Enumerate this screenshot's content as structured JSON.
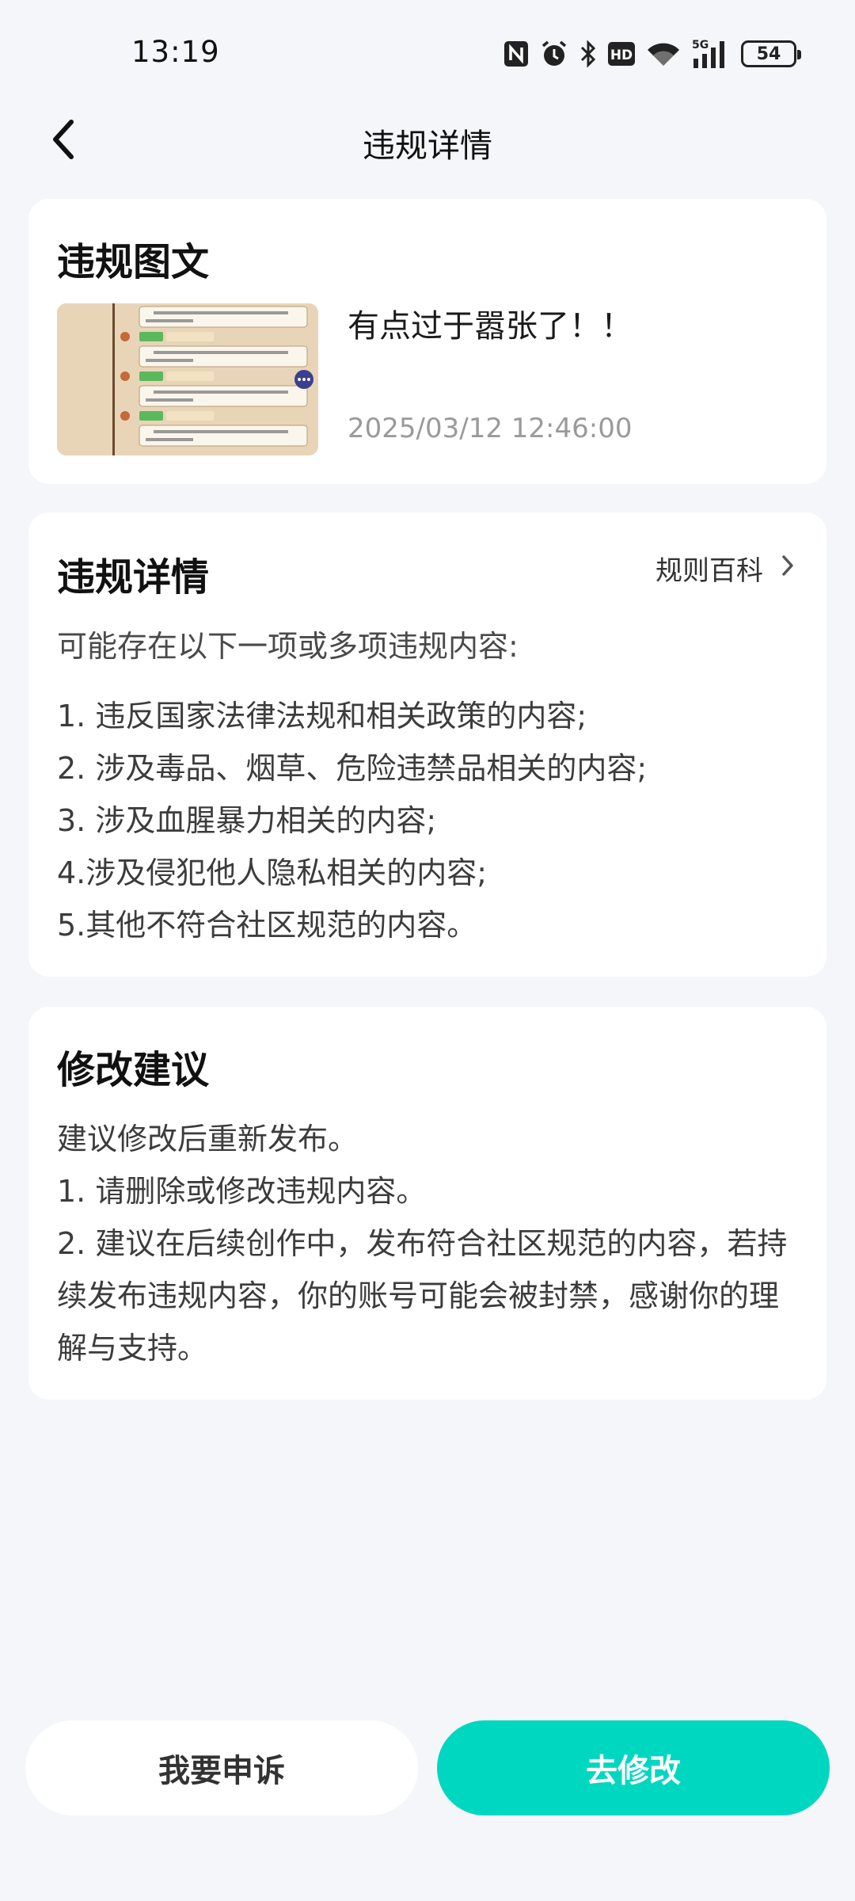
{
  "status_bar": {
    "time": "13:19",
    "battery": "54",
    "icons": [
      "nfc-icon",
      "alarm-icon",
      "bluetooth-icon",
      "hd-icon",
      "wifi-icon",
      "signal-5g-icon",
      "battery-icon"
    ]
  },
  "nav": {
    "title": "违规详情",
    "back_icon": "chevron-left-icon"
  },
  "post_card": {
    "title": "违规图文",
    "text": "有点过于嚣张了！！",
    "time": "2025/03/12 12:46:00"
  },
  "detail_card": {
    "title": "违规详情",
    "rules_link": "规则百科",
    "intro": "可能存在以下一项或多项违规内容:",
    "items": [
      "1. 违反国家法律法规和相关政策的内容;",
      "2. 涉及毒品、烟草、危险违禁品相关的内容;",
      "3. 涉及血腥暴力相关的内容;",
      "4.涉及侵犯他人隐私相关的内容;",
      "5.其他不符合社区规范的内容。"
    ]
  },
  "suggest_card": {
    "title": "修改建议",
    "lines": [
      "建议修改后重新发布。",
      "1. 请删除或修改违规内容。",
      "2. 建议在后续创作中，发布符合社区规范的内容，若持续发布违规内容，你的账号可能会被封禁，感谢你的理解与支持。"
    ]
  },
  "buttons": {
    "appeal": "我要申诉",
    "edit": "去修改"
  },
  "colors": {
    "accent": "#00d7c1",
    "background": "#f5f6f9"
  }
}
